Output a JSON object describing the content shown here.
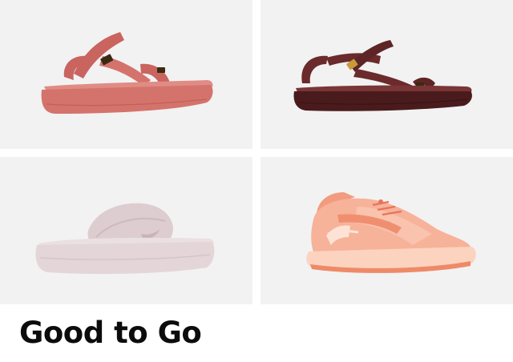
{
  "promo": {
    "title": "Good to Go",
    "tiles": [
      {
        "product": "platform-sandal-icon",
        "color": "#d4736c"
      },
      {
        "product": "strap-sandal-icon",
        "color": "#6b2a2b"
      },
      {
        "product": "slide-sandal-icon",
        "color": "#e6d8da"
      },
      {
        "product": "trail-sneaker-icon",
        "color": "#f7b29a"
      }
    ],
    "colors": {
      "tile_background": "#f2f2f2",
      "page_background": "#ffffff",
      "title_text": "#0c0c0c"
    }
  }
}
